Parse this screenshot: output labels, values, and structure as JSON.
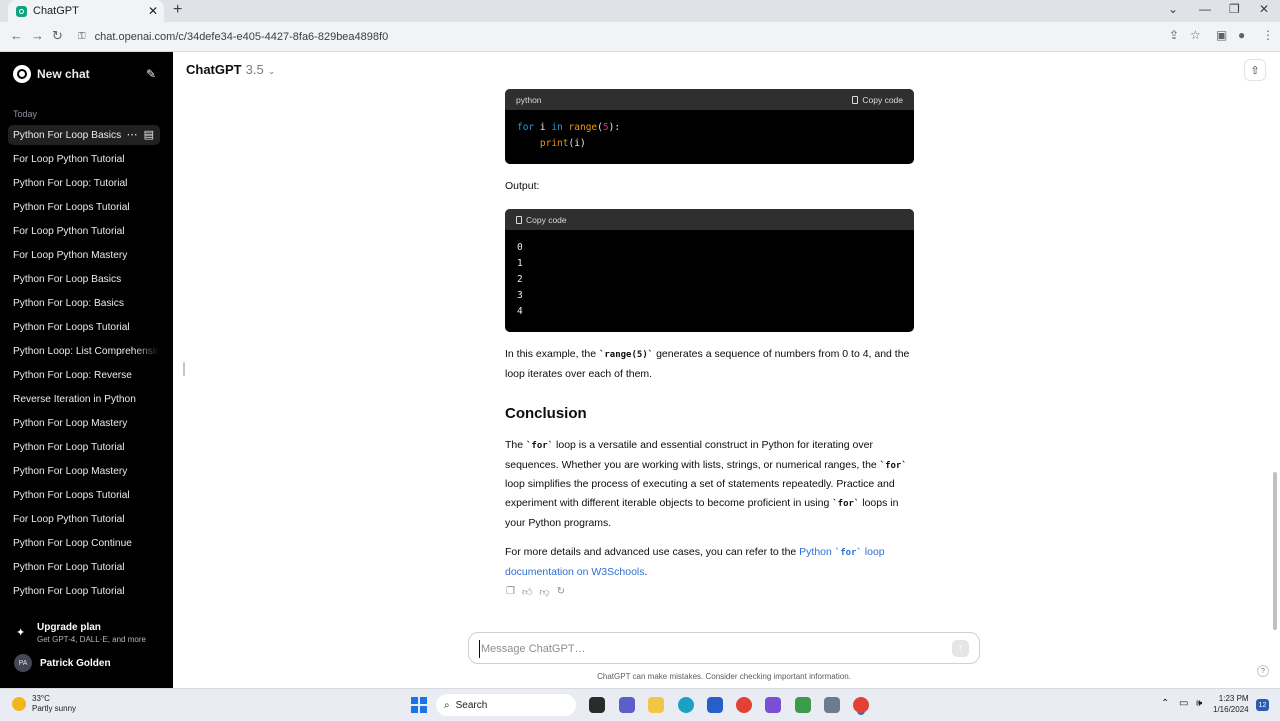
{
  "browser": {
    "tab_title": "ChatGPT",
    "new_tab": "+",
    "url": "chat.openai.com/c/34defe34-e405-4427-8fa6-829bea4898f0"
  },
  "sidebar": {
    "new_chat": "New chat",
    "today_label": "Today",
    "chats": [
      "Python For Loop Basics",
      "For Loop Python Tutorial",
      "Python For Loop: Tutorial",
      "Python For Loops Tutorial",
      "For Loop Python Tutorial",
      "For Loop Python Mastery",
      "Python For Loop Basics",
      "Python For Loop: Basics",
      "Python For Loops Tutorial",
      "Python Loop: List Comprehension",
      "Python For Loop: Reverse",
      "Reverse Iteration in Python",
      "Python For Loop Mastery",
      "Python For Loop Tutorial",
      "Python For Loop Mastery",
      "Python For Loops Tutorial",
      "For Loop Python Tutorial",
      "Python For Loop Continue",
      "Python For Loop Tutorial",
      "Python For Loop Tutorial"
    ],
    "upgrade_title": "Upgrade plan",
    "upgrade_sub": "Get GPT-4, DALL·E, and more",
    "user_initials": "PA",
    "user_name": "Patrick Golden"
  },
  "header": {
    "model_name": "ChatGPT",
    "model_version": "3.5"
  },
  "content": {
    "code1_lang": "python",
    "copy_label": "Copy code",
    "output_label": "Output:",
    "output_lines": [
      "0",
      "1",
      "2",
      "3",
      "4"
    ],
    "p1_a": "In this example, the ",
    "p1_code": "`range(5)`",
    "p1_b": " generates a sequence of numbers from 0 to 4, and the loop iterates over each of them.",
    "heading": "Conclusion",
    "p2_a": "The ",
    "p2_code1": "`for`",
    "p2_b": " loop is a versatile and essential construct in Python for iterating over sequences. Whether you are working with lists, strings, or numerical ranges, the ",
    "p2_code2": "`for`",
    "p2_c": " loop simplifies the process of executing a set of statements repeatedly. Practice and experiment with different iterable objects to become proficient in using ",
    "p2_code3": "`for`",
    "p2_d": " loops in your Python programs.",
    "p3_a": "For more details and advanced use cases, you can refer to the ",
    "p3_link_a": "Python ",
    "p3_link_code": "`for`",
    "p3_link_b": " loop documentation on W3Schools",
    "p3_end": "."
  },
  "composer": {
    "placeholder": "Message ChatGPT…",
    "disclaimer": "ChatGPT can make mistakes. Consider checking important information."
  },
  "taskbar": {
    "temp": "33°C",
    "weather": "Partly sunny",
    "search": "Search",
    "time": "1:23 PM",
    "date": "1/16/2024",
    "notifications": "12"
  },
  "colors": {
    "sidebar_bg": "#000000",
    "code_bg": "#000000",
    "link": "#2f6ed8",
    "accent": "#10a37f"
  }
}
